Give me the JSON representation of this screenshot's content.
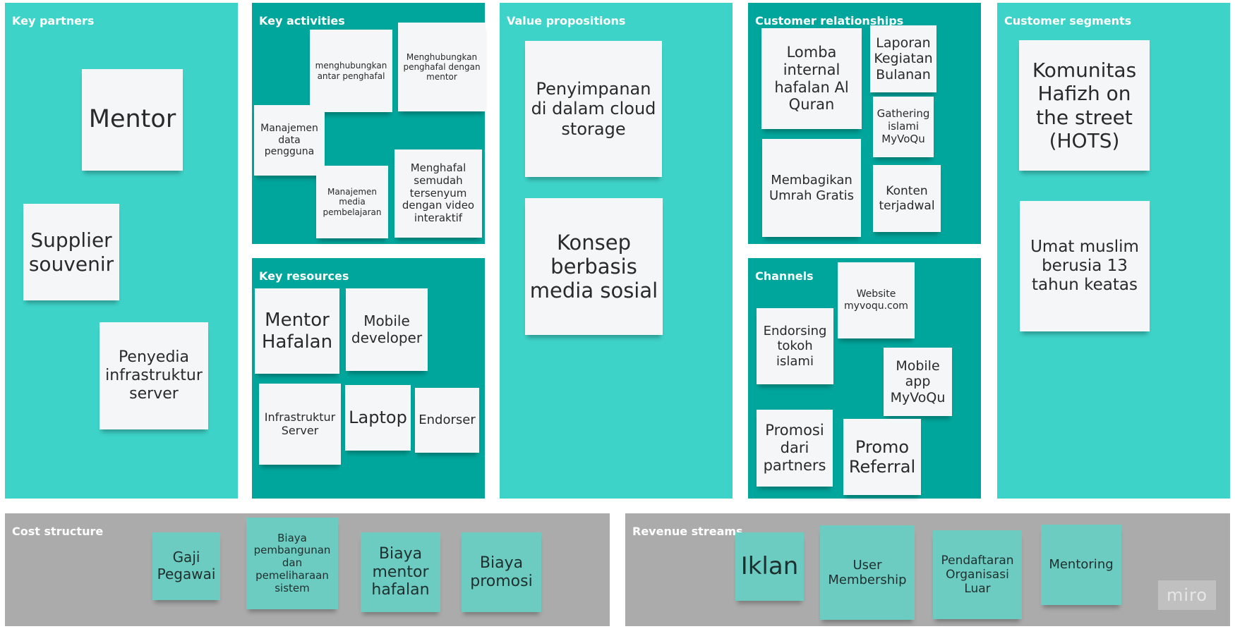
{
  "panels": {
    "key_partners": "Key partners",
    "key_activities": "Key activities",
    "key_resources": "Key resources",
    "value_propositions": "Value propositions",
    "customer_relationships": "Customer relationships",
    "channels": "Channels",
    "customer_segments": "Customer segments",
    "cost_structure": "Cost structure",
    "revenue_streams": "Revenue streams"
  },
  "notes": {
    "key_partners": [
      "Mentor",
      "Supplier souvenir",
      "Penyedia infrastruktur server"
    ],
    "key_activities": [
      "menghubungkan antar penghafal",
      "Menghubungkan penghafal dengan mentor",
      "Manajemen data pengguna",
      "Manajemen media pembelajaran",
      "Menghafal semudah tersenyum dengan video interaktif"
    ],
    "key_resources": [
      "Mentor Hafalan",
      "Mobile developer",
      "Infrastruktur Server",
      "Laptop",
      "Endorser"
    ],
    "value_propositions": [
      "Penyimpanan di dalam cloud storage",
      "Konsep berbasis media sosial"
    ],
    "customer_relationships": [
      "Lomba internal hafalan Al Quran",
      "Laporan Kegiatan Bulanan",
      "Gathering islami MyVoQu",
      "Membagikan Umrah Gratis",
      "Konten terjadwal"
    ],
    "channels": [
      "Website myvoqu.com",
      "Endorsing tokoh islami",
      "Mobile app MyVoQu",
      "Promosi dari partners",
      "Promo Referral"
    ],
    "customer_segments": [
      "Komunitas Hafizh on the street (HOTS)",
      "Umat muslim berusia 13 tahun keatas"
    ],
    "cost_structure": [
      "Gaji Pegawai",
      "Biaya pembangunan dan pemeliharaan sistem",
      "Biaya mentor hafalan",
      "Biaya promosi"
    ],
    "revenue_streams": [
      "Iklan",
      "User Membership",
      "Pendaftaran Organisasi Luar",
      "Mentoring"
    ]
  },
  "watermark": "miro",
  "colors": {
    "panel_light": "#3ed3c8",
    "panel_dark": "#00a69c",
    "panel_grey": "#ababab",
    "sticky_white": "#f4f6f7",
    "sticky_teal": "#6cccc2"
  }
}
